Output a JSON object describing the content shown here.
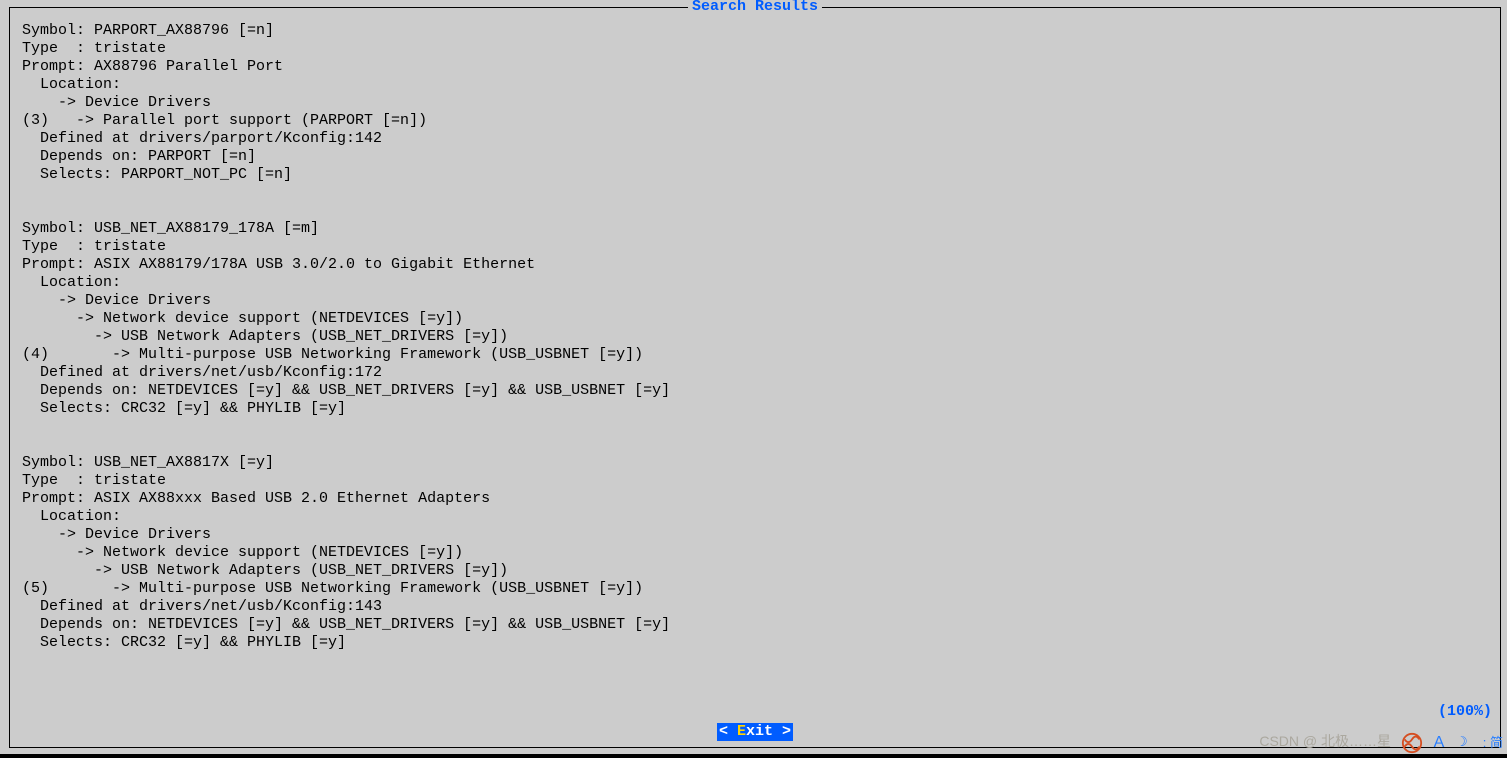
{
  "top_bar": "",
  "dialog": {
    "title": "Search Results",
    "percent": "(100%)",
    "exit_left": "< ",
    "exit_hotkey": "E",
    "exit_right": "xit >"
  },
  "content": "Symbol: PARPORT_AX88796 [=n]\nType  : tristate\nPrompt: AX88796 Parallel Port\n  Location:\n    -> Device Drivers\n(3)   -> Parallel port support (PARPORT [=n])\n  Defined at drivers/parport/Kconfig:142\n  Depends on: PARPORT [=n]\n  Selects: PARPORT_NOT_PC [=n]\n\n\nSymbol: USB_NET_AX88179_178A [=m]\nType  : tristate\nPrompt: ASIX AX88179/178A USB 3.0/2.0 to Gigabit Ethernet\n  Location:\n    -> Device Drivers\n      -> Network device support (NETDEVICES [=y])\n        -> USB Network Adapters (USB_NET_DRIVERS [=y])\n(4)       -> Multi-purpose USB Networking Framework (USB_USBNET [=y])\n  Defined at drivers/net/usb/Kconfig:172\n  Depends on: NETDEVICES [=y] && USB_NET_DRIVERS [=y] && USB_USBNET [=y]\n  Selects: CRC32 [=y] && PHYLIB [=y]\n\n\nSymbol: USB_NET_AX8817X [=y]\nType  : tristate\nPrompt: ASIX AX88xxx Based USB 2.0 Ethernet Adapters\n  Location:\n    -> Device Drivers\n      -> Network device support (NETDEVICES [=y])\n        -> USB Network Adapters (USB_NET_DRIVERS [=y])\n(5)       -> Multi-purpose USB Networking Framework (USB_USBNET [=y])\n  Defined at drivers/net/usb/Kconfig:143\n  Depends on: NETDEVICES [=y] && USB_NET_DRIVERS [=y] && USB_USBNET [=y]\n  Selects: CRC32 [=y] && PHYLIB [=y]\n",
  "watermark": "CSDN @ 北极……星",
  "ime": {
    "letter": "A",
    "moon": "☽",
    "dot": ":",
    "jian": "简"
  }
}
